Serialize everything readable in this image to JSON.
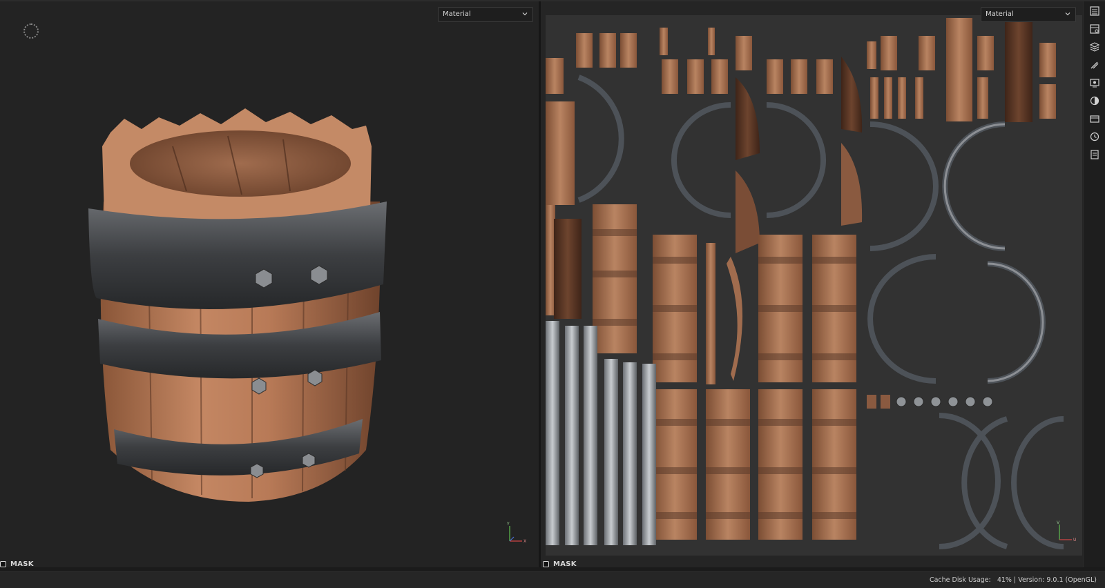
{
  "viewport_3d": {
    "dropdown_value": "Material",
    "mask_label": "MASK",
    "axis": {
      "y_label": "Y",
      "x_label": "X"
    }
  },
  "viewport_2d": {
    "dropdown_value": "Material",
    "mask_label": "MASK",
    "axis": {
      "y_label": "V",
      "x_label": "U"
    }
  },
  "sidebar": {
    "icons": [
      "texture-set-list-icon",
      "texture-set-settings-icon",
      "layers-icon",
      "properties-icon",
      "display-settings-icon",
      "shader-settings-icon",
      "shelf-icon",
      "history-icon",
      "log-icon"
    ]
  },
  "status": {
    "cache_label": "Cache Disk Usage:",
    "cache_value": "41%",
    "separator": "|",
    "version_text": "Version: 9.0.1 (OpenGL)"
  },
  "colors": {
    "wood": "#b57a57",
    "wood_dark": "#6e4530",
    "metal": "#4a4c4f",
    "metal_light": "#9a9ea3",
    "background": "#232323",
    "uv_background": "#323232"
  }
}
